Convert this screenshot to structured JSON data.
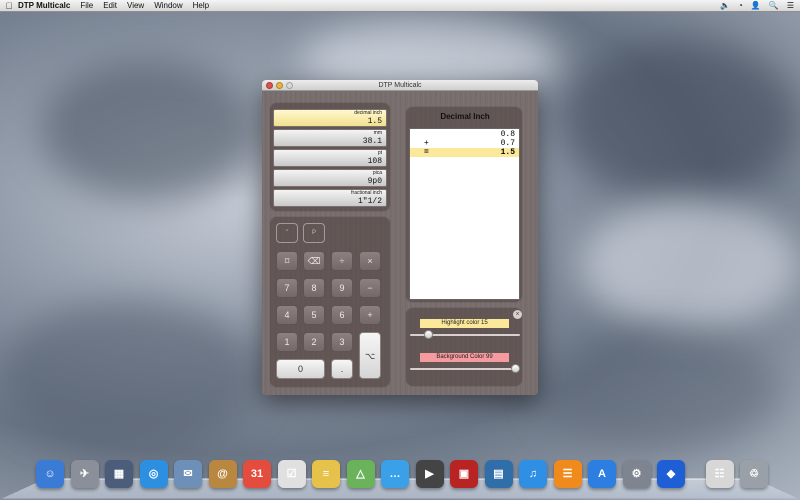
{
  "menubar": {
    "apple": "",
    "app_name": "DTP Multicalc",
    "menus": [
      "File",
      "Edit",
      "View",
      "Window",
      "Help"
    ],
    "status_icons": [
      "volume-icon",
      "wifi-icon",
      "user-icon",
      "search-icon",
      "list-icon"
    ]
  },
  "window": {
    "title": "DTP Multicalc"
  },
  "units": [
    {
      "label": "decimal inch",
      "value": "1.5",
      "active": true
    },
    {
      "label": "mm",
      "value": "38.1"
    },
    {
      "label": "pt",
      "value": "108"
    },
    {
      "label": "pica",
      "value": "9p0"
    },
    {
      "label": "fractional inch",
      "value": "1\"1/2"
    }
  ],
  "keypad": {
    "mode_keys": [
      "\"",
      "P"
    ],
    "row1": [
      "⌑",
      "⌫",
      "÷",
      "×"
    ],
    "row2": [
      "7",
      "8",
      "9",
      "−"
    ],
    "row3": [
      "4",
      "5",
      "6",
      "+"
    ],
    "row4": [
      "1",
      "2",
      "3"
    ],
    "zero": "0",
    "dot": ".",
    "equals": "⌥"
  },
  "tape": {
    "title": "Decimal Inch",
    "lines": [
      {
        "op": "",
        "value": "0.8"
      },
      {
        "op": "+",
        "value": "0.7"
      },
      {
        "op": "=",
        "value": "1.5",
        "highlight": true
      }
    ]
  },
  "colors": {
    "highlight_label": "Highlight color 15",
    "highlight_hex": "#fbe89b",
    "highlight_level": 0.15,
    "background_label": "Background Color 99",
    "background_hex": "#f59a9f",
    "background_level": 0.99
  },
  "dock": [
    {
      "name": "finder",
      "glyph": "☺",
      "color": "#3a7bd5"
    },
    {
      "name": "launchpad",
      "glyph": "✈",
      "color": "#8a8f99"
    },
    {
      "name": "mission-control",
      "glyph": "▦",
      "color": "#4b5d7a"
    },
    {
      "name": "safari",
      "glyph": "◎",
      "color": "#2d8fe0"
    },
    {
      "name": "mail",
      "glyph": "✉",
      "color": "#6e8fb8"
    },
    {
      "name": "contacts",
      "glyph": "@",
      "color": "#b9873f"
    },
    {
      "name": "calendar",
      "glyph": "31",
      "color": "#e44d3d"
    },
    {
      "name": "reminders",
      "glyph": "☑",
      "color": "#e0e0e0"
    },
    {
      "name": "notes",
      "glyph": "≡",
      "color": "#e6c24a"
    },
    {
      "name": "maps",
      "glyph": "△",
      "color": "#6bb35a"
    },
    {
      "name": "messages",
      "glyph": "…",
      "color": "#3aa0e8"
    },
    {
      "name": "facetime",
      "glyph": "▶",
      "color": "#444444"
    },
    {
      "name": "photo-booth",
      "glyph": "▣",
      "color": "#b82424"
    },
    {
      "name": "iphoto",
      "glyph": "▤",
      "color": "#2f6ea8"
    },
    {
      "name": "itunes",
      "glyph": "♫",
      "color": "#2f8fe5"
    },
    {
      "name": "ibooks",
      "glyph": "☰",
      "color": "#f08a1c"
    },
    {
      "name": "app-store",
      "glyph": "A",
      "color": "#2c7fe0"
    },
    {
      "name": "system-preferences",
      "glyph": "⚙",
      "color": "#7f8590"
    },
    {
      "name": "dtp-multicalc",
      "glyph": "◆",
      "color": "#1e5fd6"
    },
    {
      "name": "documents",
      "glyph": "☷",
      "color": "#d7d7d7"
    },
    {
      "name": "trash",
      "glyph": "♲",
      "color": "#9aa0a8"
    }
  ]
}
